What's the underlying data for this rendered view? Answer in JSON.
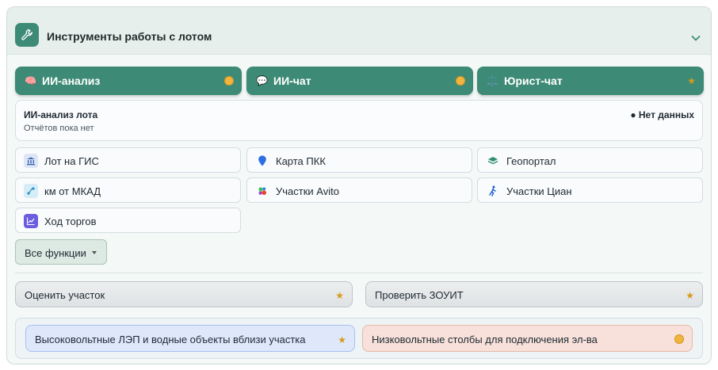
{
  "header": {
    "title": "Инструменты работы с лотом",
    "icon": "wrench-icon"
  },
  "ai_buttons": [
    {
      "label": "ИИ-анализ",
      "emoji": "🧠",
      "badge": "orange-dot"
    },
    {
      "label": "ИИ-чат",
      "emoji": "💬",
      "badge": "orange-dot"
    },
    {
      "label": "Юрист-чат",
      "emoji": "⚖️",
      "badge": "★"
    }
  ],
  "analysis": {
    "title": "ИИ-анализ лота",
    "subtitle": "Отчётов пока нет",
    "status": "● Нет данных"
  },
  "tools": [
    {
      "label": "Лот на ГИС",
      "icon": "bank-icon"
    },
    {
      "label": "Карта ПКК",
      "icon": "map-pin-icon"
    },
    {
      "label": "Геопортал",
      "icon": "layers-icon"
    },
    {
      "label": "км от МКАД",
      "icon": "route-icon"
    },
    {
      "label": "Участки Avito",
      "icon": "avito-icon"
    },
    {
      "label": "Участки Циан",
      "icon": "cian-icon"
    },
    {
      "label": "Ход торгов",
      "icon": "chart-icon"
    }
  ],
  "all_functions": {
    "label": "Все функции"
  },
  "evaluate": [
    {
      "label": "Оценить участок",
      "badge": "★"
    },
    {
      "label": "Проверить ЗОУИТ",
      "badge": "★"
    }
  ],
  "chips": [
    {
      "label": "Высоковольтные ЛЭП и водные объекты вблизи участка",
      "badge": "★"
    },
    {
      "label": "Низковольтные столбы для подключения эл-ва",
      "badge": "orange-dot"
    }
  ],
  "colors": {
    "accent": "#3d8b76",
    "star": "#d89a1a",
    "dot": "#f0b440"
  }
}
